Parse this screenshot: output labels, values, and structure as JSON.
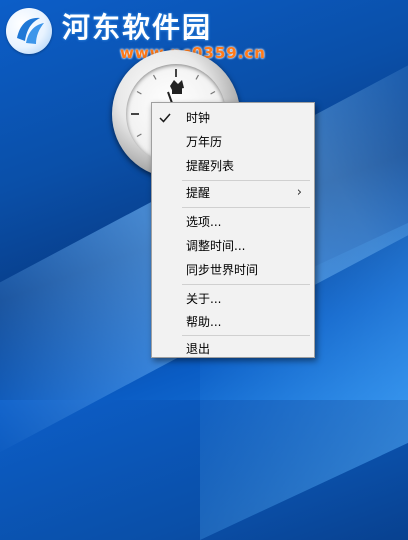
{
  "watermark": {
    "site_title": "河东软件园",
    "site_url": "www.pc0359.cn"
  },
  "context_menu": {
    "items": [
      {
        "label": "时钟",
        "checked": true
      },
      {
        "label": "万年历"
      },
      {
        "label": "提醒列表"
      },
      {
        "label": "提醒",
        "submenu_arrow": "›"
      },
      {
        "label": "选项..."
      },
      {
        "label": "调整时间..."
      },
      {
        "label": "同步世界时间"
      },
      {
        "label": "关于..."
      },
      {
        "label": "帮助..."
      },
      {
        "label": "退出"
      }
    ]
  },
  "icons": {
    "check": "checkmark-icon",
    "submenu": "chevron-right-icon",
    "logo": "hedong-logo-icon"
  },
  "colors": {
    "desktop_blue": "#0a4fa8",
    "menu_bg": "#f2f2f2",
    "url_orange": "#ff7a1a"
  }
}
